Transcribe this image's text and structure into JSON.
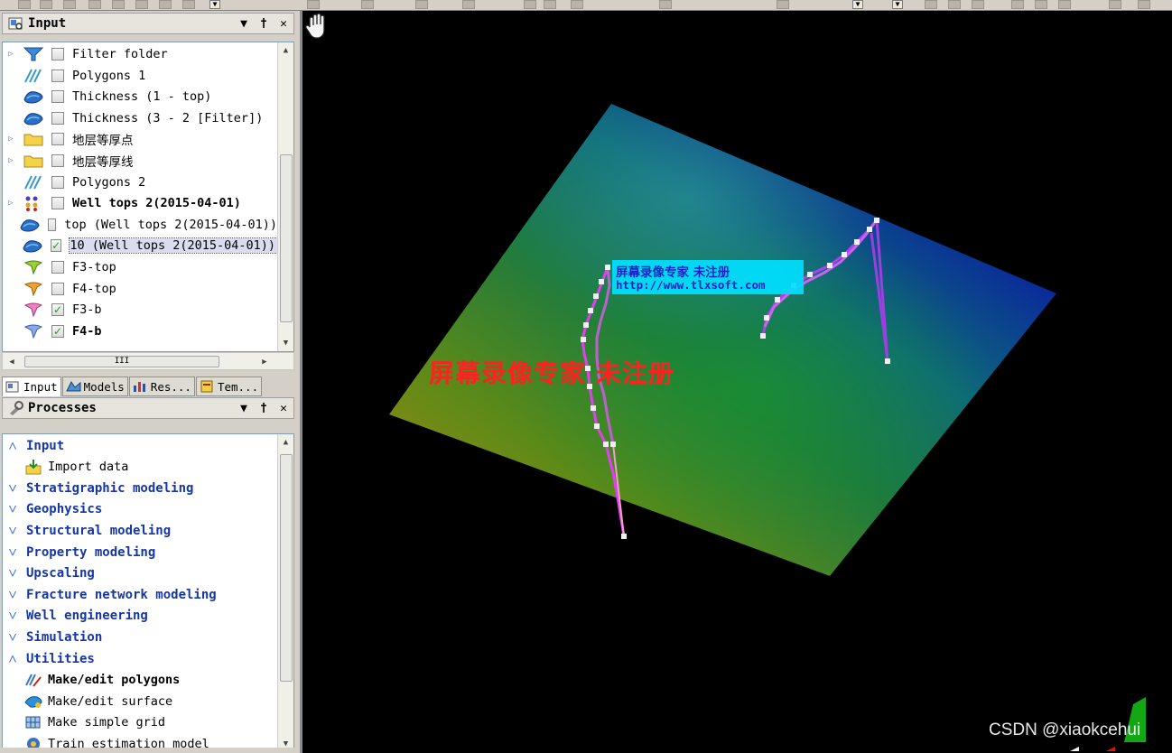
{
  "input_panel": {
    "title": "Input",
    "pin_label": "↓",
    "pushpin_label": "†",
    "close_label": "✕",
    "items": [
      {
        "label": "Filter folder",
        "icon": "filter-folder-icon",
        "checked": false,
        "expander": true,
        "bold": false
      },
      {
        "label": "Polygons 1",
        "icon": "polygons-icon",
        "checked": false,
        "expander": false,
        "bold": false
      },
      {
        "label": "Thickness (1 - top)",
        "icon": "surface-icon",
        "checked": false,
        "expander": false,
        "bold": false
      },
      {
        "label": "Thickness (3 - 2 [Filter])",
        "icon": "surface-icon",
        "checked": false,
        "expander": false,
        "bold": false
      },
      {
        "label": "地层等厚点",
        "icon": "folder-icon",
        "checked": false,
        "expander": true,
        "bold": false
      },
      {
        "label": "地层等厚线",
        "icon": "folder-icon",
        "checked": false,
        "expander": true,
        "bold": false
      },
      {
        "label": "Polygons 2",
        "icon": "polygons-icon",
        "checked": false,
        "expander": false,
        "bold": false
      },
      {
        "label": "Well tops 2(2015-04-01)",
        "icon": "well-tops-icon",
        "checked": false,
        "expander": true,
        "bold": true
      },
      {
        "label": "top (Well tops 2(2015-04-01))",
        "icon": "surface-icon",
        "checked": false,
        "expander": false,
        "bold": false
      },
      {
        "label": "10 (Well tops 2(2015-04-01))",
        "icon": "surface-icon",
        "checked": true,
        "expander": false,
        "bold": false,
        "selected": true
      },
      {
        "label": "F3-top",
        "icon": "fault-green-icon",
        "checked": false,
        "expander": false,
        "bold": false
      },
      {
        "label": "F4-top",
        "icon": "fault-orange-icon",
        "checked": false,
        "expander": false,
        "bold": false
      },
      {
        "label": "F3-b",
        "icon": "fault-pink-icon",
        "checked": true,
        "expander": false,
        "bold": false
      },
      {
        "label": "F4-b",
        "icon": "fault-blue-icon",
        "checked": true,
        "expander": false,
        "bold": true
      }
    ],
    "hscroll_grip": "III"
  },
  "pane_tabs": [
    {
      "label": "Input",
      "icon": "input-tab-icon",
      "active": true
    },
    {
      "label": "Models",
      "icon": "models-tab-icon",
      "active": false
    },
    {
      "label": "Res...",
      "icon": "results-tab-icon",
      "active": false
    },
    {
      "label": "Tem...",
      "icon": "templates-tab-icon",
      "active": false
    }
  ],
  "processes_panel": {
    "title": "Processes",
    "rows": [
      {
        "type": "category",
        "label": "Input",
        "expanded": true
      },
      {
        "type": "item",
        "label": "Import data",
        "icon": "import-data-icon",
        "bold": false
      },
      {
        "type": "category",
        "label": "Stratigraphic modeling",
        "expanded": false
      },
      {
        "type": "category",
        "label": "Geophysics",
        "expanded": false
      },
      {
        "type": "category",
        "label": "Structural modeling",
        "expanded": false
      },
      {
        "type": "category",
        "label": "Property modeling",
        "expanded": false
      },
      {
        "type": "category",
        "label": "Upscaling",
        "expanded": false
      },
      {
        "type": "category",
        "label": "Fracture network modeling",
        "expanded": false
      },
      {
        "type": "category",
        "label": "Well engineering",
        "expanded": false
      },
      {
        "type": "category",
        "label": "Simulation",
        "expanded": false
      },
      {
        "type": "category",
        "label": "Utilities",
        "expanded": true
      },
      {
        "type": "item",
        "label": "Make/edit polygons",
        "icon": "make-polygons-icon",
        "bold": true
      },
      {
        "type": "item",
        "label": "Make/edit surface",
        "icon": "make-surface-icon",
        "bold": false
      },
      {
        "type": "item",
        "label": "Make simple grid",
        "icon": "simple-grid-icon",
        "bold": false
      },
      {
        "type": "item",
        "label": "Train estimation model",
        "icon": "train-model-icon",
        "bold": false
      }
    ]
  },
  "viewport": {
    "watermark_box_line1": "屏幕录像专家     未注册",
    "watermark_box_line2": "http://www.tlxsoft.com",
    "watermark_big": "屏幕录像专家  未注册",
    "credit": "CSDN @xiaokcehui"
  },
  "colors": {
    "category_text": "#1636a8",
    "check_mark": "#21a121",
    "fault_line": "#e040f0",
    "watermark_red": "#ff2020",
    "watermark_cyan": "#00e0ff"
  }
}
